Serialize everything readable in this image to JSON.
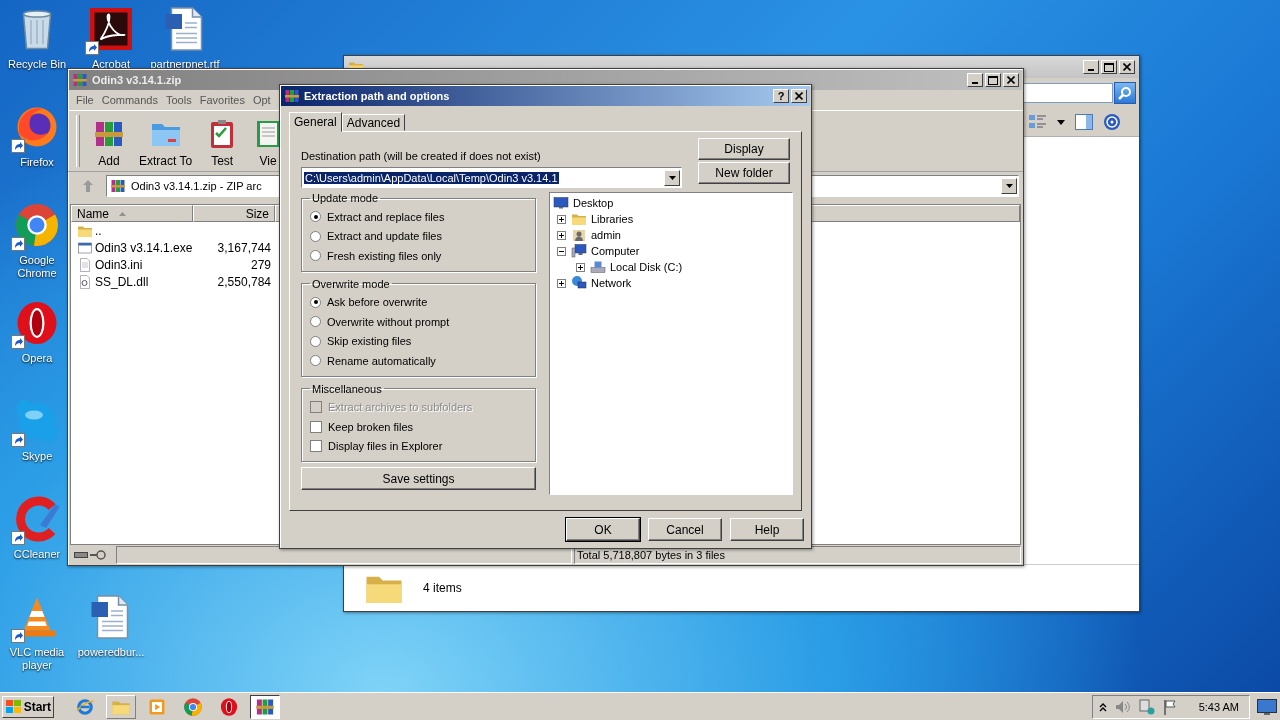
{
  "desktop_icons": [
    {
      "label": "Recycle Bin",
      "kind": "recycle",
      "shortcut": false
    },
    {
      "label": "Acrobat",
      "kind": "pdf",
      "shortcut": true
    },
    {
      "label": "partnerpnet.rtf",
      "kind": "doc",
      "shortcut": false
    },
    {
      "label": "Firefox",
      "kind": "firefox",
      "shortcut": true
    },
    {
      "label": "Google Chrome",
      "kind": "chrome",
      "shortcut": true
    },
    {
      "label": "Opera",
      "kind": "opera",
      "shortcut": true
    },
    {
      "label": "Skype",
      "kind": "skype",
      "shortcut": true
    },
    {
      "label": "CCleaner",
      "kind": "ccleaner",
      "shortcut": true
    },
    {
      "label": "VLC media player",
      "kind": "vlc",
      "shortcut": true
    },
    {
      "label": "poweredbur...",
      "kind": "doc",
      "shortcut": false
    }
  ],
  "explorer_window": {
    "details": "4 items"
  },
  "archive_window": {
    "title": "Odin3 v3.14.1.zip",
    "menu": [
      "File",
      "Commands",
      "Tools",
      "Favorites",
      "Opt"
    ],
    "toolbar": [
      {
        "label": "Add",
        "kind": "add"
      },
      {
        "label": "Extract To",
        "kind": "extract"
      },
      {
        "label": "Test",
        "kind": "test"
      },
      {
        "label": "Vie",
        "kind": "view"
      }
    ],
    "address": "Odin3 v3.14.1.zip - ZIP arc",
    "columns": [
      "Name",
      "Size"
    ],
    "files": [
      {
        "name": "..",
        "kind": "up"
      },
      {
        "name": "Odin3 v3.14.1.exe",
        "size": "3,167,744",
        "kind": "exe"
      },
      {
        "name": "Odin3.ini",
        "size": "279",
        "kind": "ini"
      },
      {
        "name": "SS_DL.dll",
        "size": "2,550,784",
        "kind": "dll"
      }
    ],
    "status": "Total 5,718,807 bytes in 3 files"
  },
  "dialog": {
    "title": "Extraction path and options",
    "help_button": "?",
    "tabs": [
      {
        "label": "General",
        "selected": true
      },
      {
        "label": "Advanced",
        "selected": false
      }
    ],
    "destination_label": "Destination path (will be created if does not exist)",
    "destination_value": "C:\\Users\\admin\\AppData\\Local\\Temp\\Odin3 v3.14.1",
    "side_buttons": [
      "Display",
      "New folder"
    ],
    "groups": [
      {
        "title": "Update mode",
        "kind": "radio",
        "options": [
          {
            "label": "Extract and replace files",
            "selected": true
          },
          {
            "label": "Extract and update files",
            "selected": false
          },
          {
            "label": "Fresh existing files only",
            "selected": false
          }
        ]
      },
      {
        "title": "Overwrite mode",
        "kind": "radio",
        "options": [
          {
            "label": "Ask before overwrite",
            "selected": true
          },
          {
            "label": "Overwrite without prompt",
            "selected": false
          },
          {
            "label": "Skip existing files",
            "selected": false
          },
          {
            "label": "Rename automatically",
            "selected": false
          }
        ]
      },
      {
        "title": "Miscellaneous",
        "kind": "checkbox",
        "options": [
          {
            "label": "Extract archives to subfolders",
            "checked": false,
            "disabled": true
          },
          {
            "label": "Keep broken files",
            "checked": false,
            "disabled": false
          },
          {
            "label": "Display files in Explorer",
            "checked": false,
            "disabled": false
          }
        ]
      }
    ],
    "save_button": "Save settings",
    "tree": [
      {
        "label": "Desktop",
        "kind": "desktop",
        "children": [
          {
            "label": "Libraries",
            "kind": "libraries",
            "expanded": false
          },
          {
            "label": "admin",
            "kind": "user",
            "expanded": false
          },
          {
            "label": "Computer",
            "kind": "computer",
            "expanded": true,
            "children": [
              {
                "label": "Local Disk (C:)",
                "kind": "drive",
                "expanded": false
              }
            ]
          },
          {
            "label": "Network",
            "kind": "network",
            "expanded": false
          }
        ]
      }
    ],
    "buttons": [
      "OK",
      "Cancel",
      "Help"
    ]
  },
  "taskbar": {
    "start": "Start",
    "apps": [
      {
        "kind": "ie",
        "open": false,
        "selected": false
      },
      {
        "kind": "explorer",
        "open": true,
        "selected": false
      },
      {
        "kind": "media",
        "open": false,
        "selected": false
      },
      {
        "kind": "chrome",
        "open": false,
        "selected": false
      },
      {
        "kind": "opera",
        "open": false,
        "selected": false
      },
      {
        "kind": "archive",
        "open": true,
        "selected": true
      }
    ],
    "clock": "5:43 AM"
  }
}
